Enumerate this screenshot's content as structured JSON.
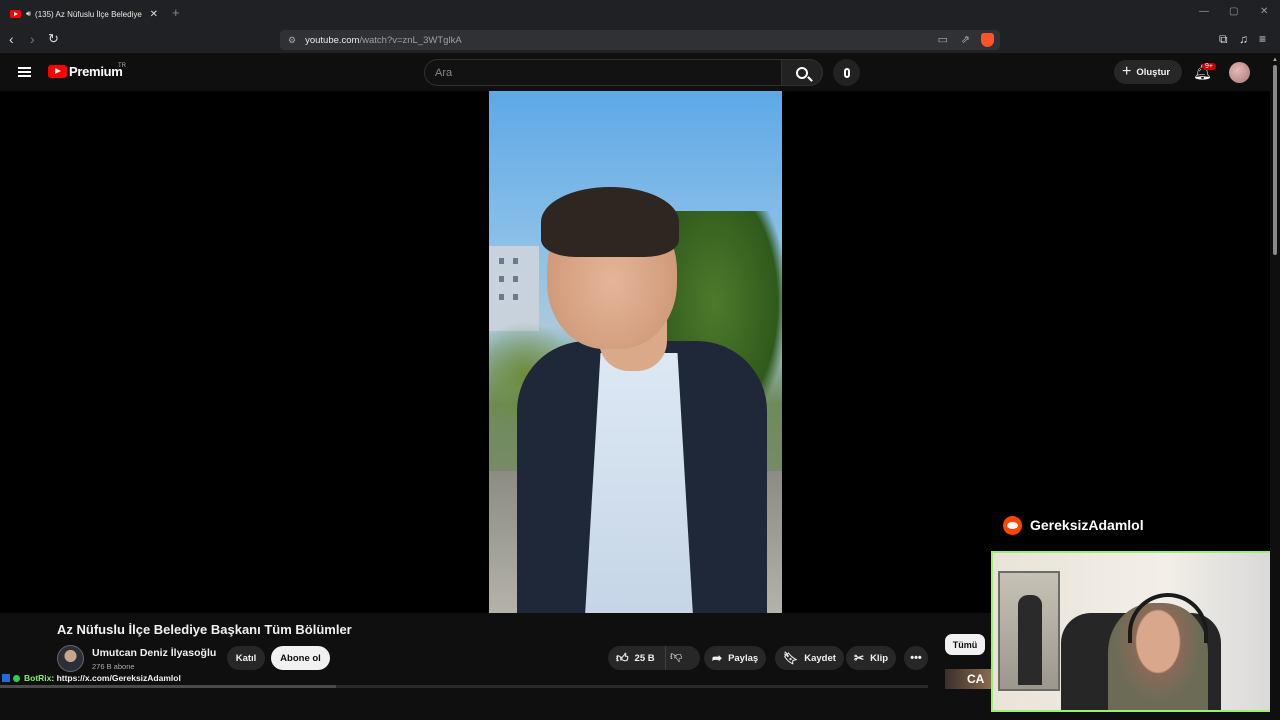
{
  "browser": {
    "tab_title": "(135) Az Nüfuslu İlçe Belediye",
    "url_host": "youtube.com",
    "url_path": "/watch?v=znL_3WTglkA",
    "icons": [
      "back-icon",
      "forward-icon",
      "reload-icon",
      "site-settings-icon",
      "cast-icon",
      "share-icon",
      "brave-shield-icon",
      "extensions-icon",
      "music-icon",
      "menu-icon"
    ]
  },
  "masthead": {
    "brand": "Premium",
    "country": "TR",
    "search_placeholder": "Ara",
    "create_label": "Oluştur",
    "notif_badge": "9+"
  },
  "video": {
    "title": "Az Nüfuslu İlçe Belediye Başkanı Tüm Bölümler",
    "channel_name": "Umutcan Deniz İlyasoğlu",
    "subscribers": "276 B abone",
    "join_label": "Katıl",
    "subscribe_label": "Abone ol",
    "likes": "25 B",
    "share_label": "Paylaş",
    "save_label": "Kaydet",
    "clip_label": "Klip",
    "more_label": "•••"
  },
  "sidebar": {
    "chip_all": "Tümü",
    "thumb_text": "CA"
  },
  "overlay": {
    "bot_name": "BotRix",
    "bot_message": ": https://x.com/GereksizAdamlol",
    "reddit_user": "GereksizAdamlol"
  },
  "colors": {
    "yt_red": "#ff0000",
    "cam_border": "#9bf06e",
    "reddit": "#ff4500"
  }
}
